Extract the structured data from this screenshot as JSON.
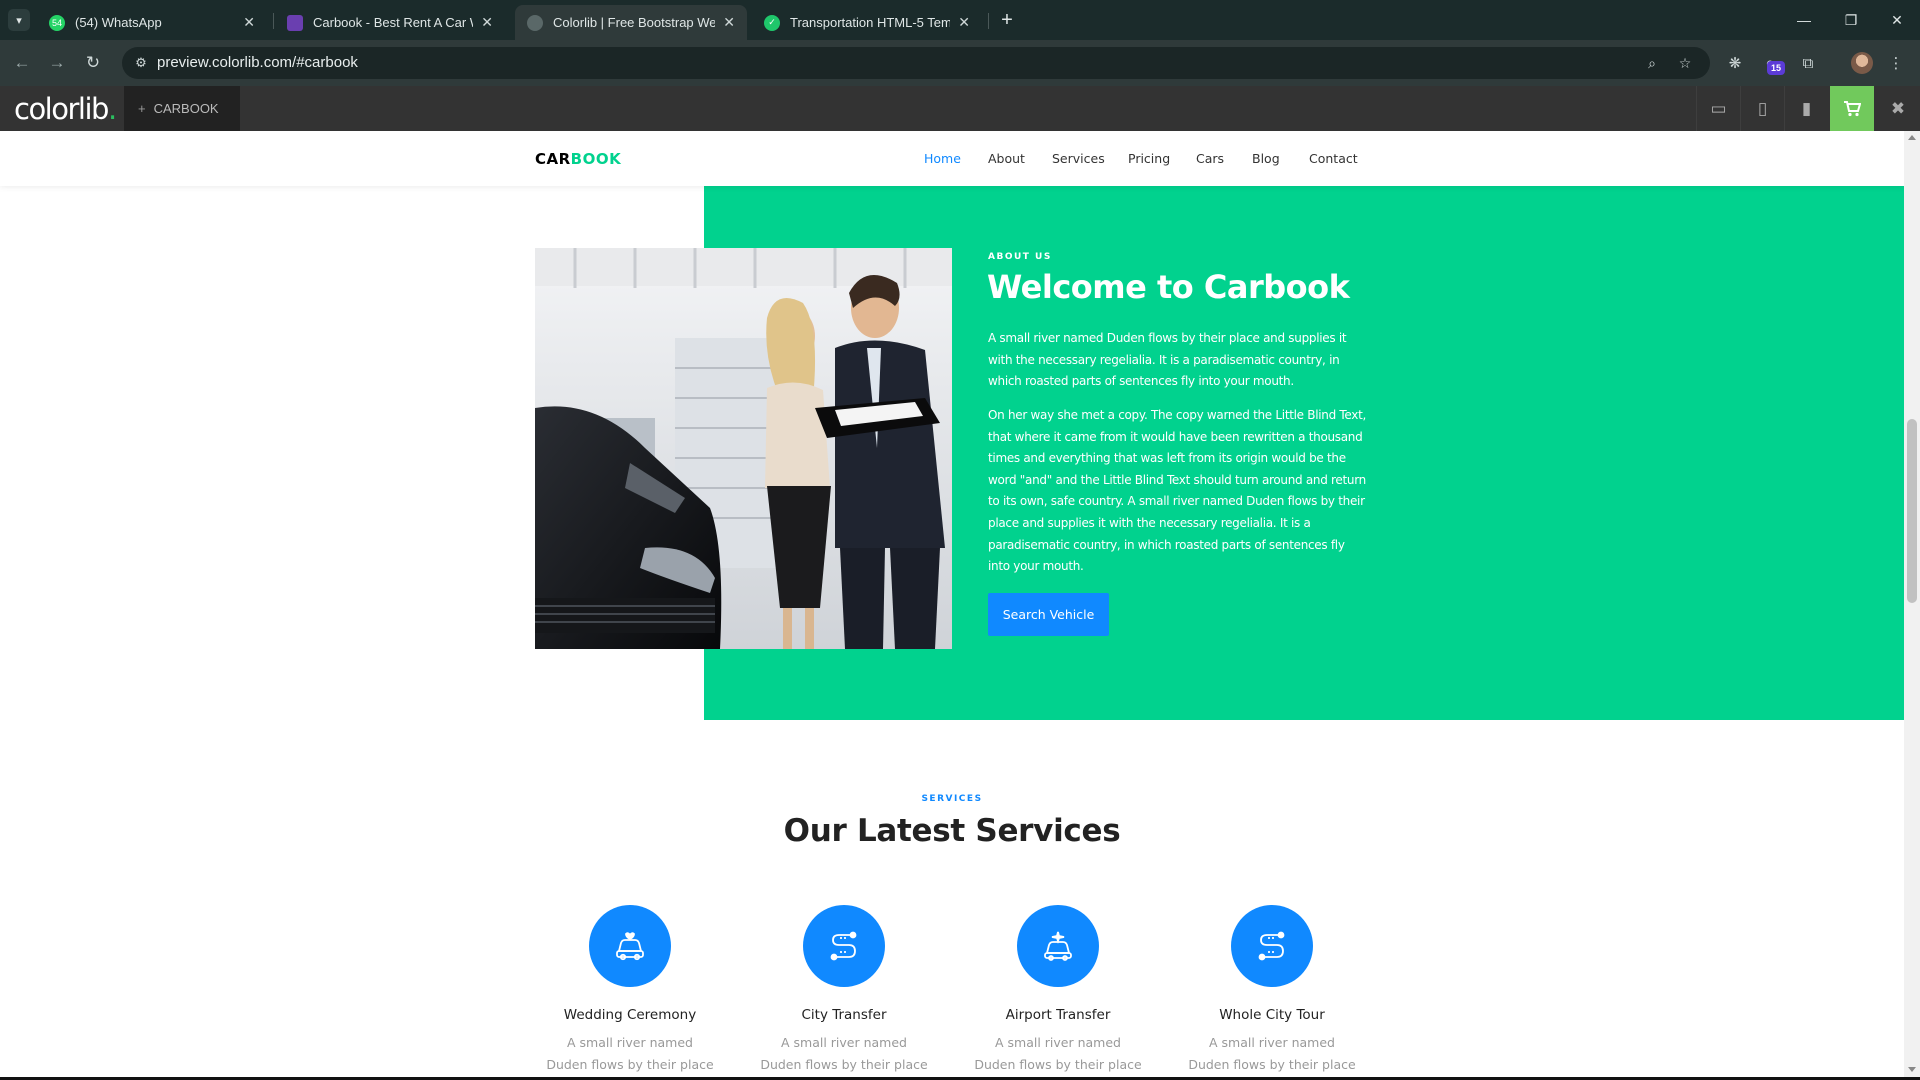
{
  "browser": {
    "tabs": [
      {
        "title": "(54) WhatsApp",
        "icon": "whatsapp-icon",
        "favicon_color": "#25d366",
        "favicon_text": "54",
        "active": false
      },
      {
        "title": "Carbook - Best Rent A Car Websi",
        "icon": "colorlib-favicon",
        "favicon_color": "#6a3fb0",
        "favicon_text": "",
        "active": false
      },
      {
        "title": "Colorlib | Free Bootstrap Websi",
        "icon": "globe-icon",
        "favicon_color": "#5a6868",
        "favicon_text": "",
        "active": true
      },
      {
        "title": "Transportation HTML-5 Templat",
        "icon": "check-icon",
        "favicon_color": "#1fc76b",
        "favicon_text": "✓",
        "active": false
      }
    ],
    "url": "preview.colorlib.com/#carbook",
    "extension_badge": "15"
  },
  "preview_bar": {
    "logo_text": "colorlib",
    "logo_dot": ".",
    "project_plus": "+",
    "project_name": "CARBOOK"
  },
  "site": {
    "brand_part1": "CAR",
    "brand_part2": "BOOK",
    "nav": [
      {
        "label": "Home",
        "active": true
      },
      {
        "label": "About",
        "active": false
      },
      {
        "label": "Services",
        "active": false
      },
      {
        "label": "Pricing",
        "active": false
      },
      {
        "label": "Cars",
        "active": false
      },
      {
        "label": "Blog",
        "active": false
      },
      {
        "label": "Contact",
        "active": false
      }
    ],
    "about": {
      "subheading": "ABOUT US",
      "title": "Welcome to Carbook",
      "paragraph1": "A small river named Duden flows by their place and supplies it with the necessary regelialia. It is a paradisematic country, in which roasted parts of sentences fly into your mouth.",
      "paragraph2": "On her way she met a copy. The copy warned the Little Blind Text, that where it came from it would have been rewritten a thousand times and everything that was left from its origin would be the word \"and\" and the Little Blind Text should turn around and return to its own, safe country. A small river named Duden flows by their place and supplies it with the necessary regelialia. It is a paradisematic country, in which roasted parts of sentences fly into your mouth.",
      "button": "Search Vehicle"
    },
    "services": {
      "subheading": "SERVICES",
      "title": "Our Latest Services",
      "items": [
        {
          "name": "Wedding Ceremony",
          "icon": "wedding-car-icon",
          "desc": "A small river named Duden flows by their place and"
        },
        {
          "name": "City Transfer",
          "icon": "route-icon",
          "desc": "A small river named Duden flows by their place and"
        },
        {
          "name": "Airport Transfer",
          "icon": "airport-car-icon",
          "desc": "A small river named Duden flows by their place and"
        },
        {
          "name": "Whole City Tour",
          "icon": "city-tour-icon",
          "desc": "A small river named Duden flows by their place and"
        }
      ]
    },
    "colors": {
      "green": "#01d28e",
      "blue": "#1089ff"
    }
  }
}
